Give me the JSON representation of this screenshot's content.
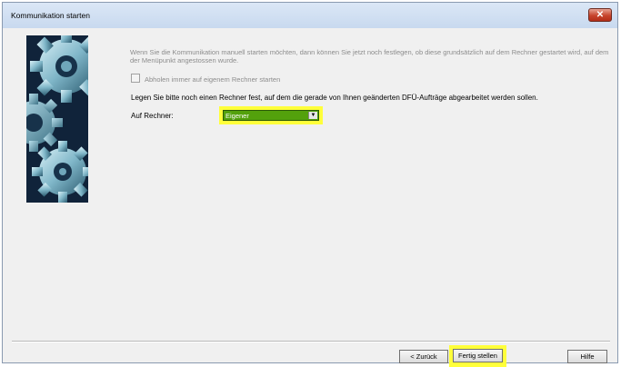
{
  "window": {
    "title": "Kommunikation starten",
    "close_label": "✕"
  },
  "content": {
    "description": "Wenn Sie die Kommunikation manuell starten möchten, dann können Sie jetzt noch festlegen, ob diese grundsätzlich auf dem Rechner gestartet wird, auf dem der Menüpunkt angestossen wurde.",
    "checkbox_label": "Abholen immer auf eigenem Rechner starten",
    "checkbox_checked": false,
    "prompt": "Legen Sie bitte noch einen Rechner fest, auf dem die gerade von Ihnen geänderten DFÜ-Aufträge abgearbeitet werden sollen.",
    "rechner_label": "Auf Rechner:",
    "rechner_value": "Eigener"
  },
  "buttons": {
    "back": "< Zurück",
    "finish": "Fertig stellen",
    "help": "Hilfe"
  },
  "colors": {
    "highlight": "#ffff3a",
    "select_bg": "#53a10c",
    "title_bg": "#c8d9ef"
  }
}
